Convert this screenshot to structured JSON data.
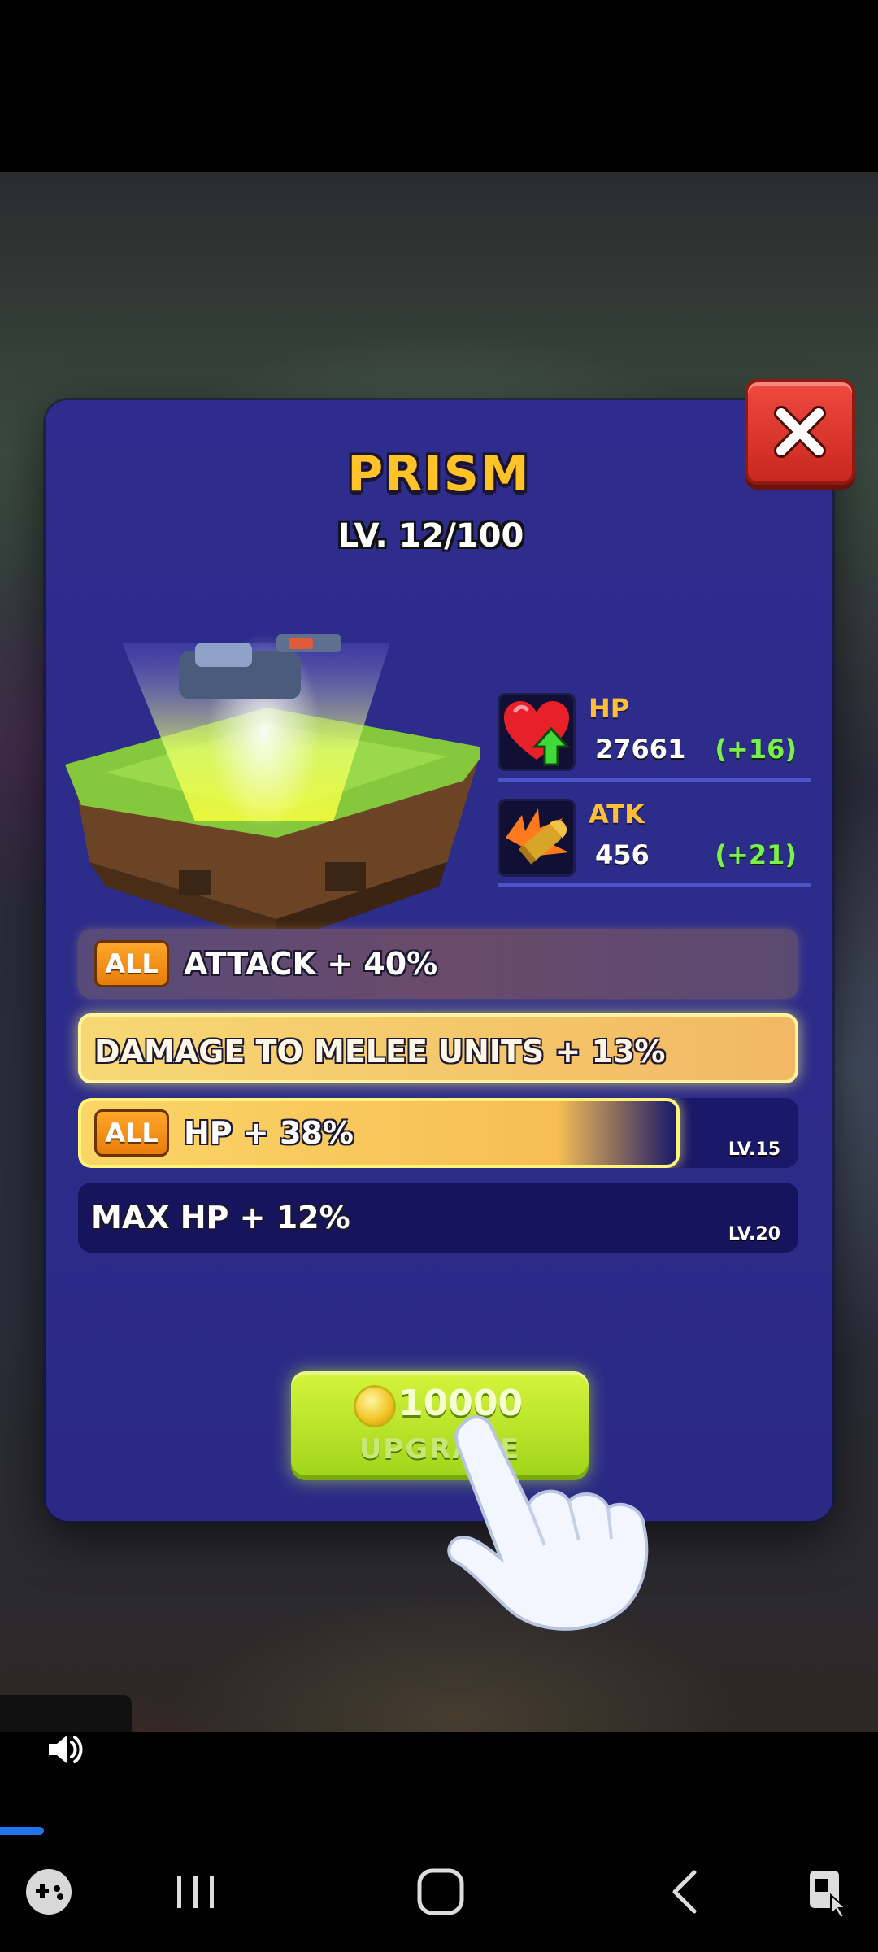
{
  "unit": {
    "name": "PRISM",
    "level": "LV. 12/100"
  },
  "stats": [
    {
      "name": "HP",
      "value": "27661",
      "bonus": "(+16)",
      "icon": "heart-up-icon"
    },
    {
      "name": "ATK",
      "value": "456",
      "bonus": "(+21)",
      "icon": "bullet-icon"
    }
  ],
  "skills": [
    {
      "badge": "ALL",
      "text": "ATTACK +  40%",
      "level_tag": ""
    },
    {
      "badge": "",
      "text": "DAMAGE TO MELEE UNITS +  13%",
      "level_tag": ""
    },
    {
      "badge": "ALL",
      "text": "HP +  38%",
      "level_tag": "LV.15"
    },
    {
      "badge": "",
      "text": "MAX HP +  12%",
      "level_tag": "LV.20"
    }
  ],
  "upgrade": {
    "price": "10000",
    "label": "UPGRADE"
  },
  "colors": {
    "dialog": "#2e2d8d",
    "title": "#ffc328",
    "bonus": "#7cf04a",
    "close": "#e23b30",
    "upgrade": "#c6ec2c",
    "progress": "#2374e8"
  },
  "icons": {
    "close": "close-icon",
    "hand": "pointing-hand-icon",
    "speaker": "speaker-icon",
    "coin": "coin-icon",
    "nav": [
      "game-controller-icon",
      "recent-apps-icon",
      "home-icon",
      "back-icon",
      "screenshot-icon"
    ]
  }
}
